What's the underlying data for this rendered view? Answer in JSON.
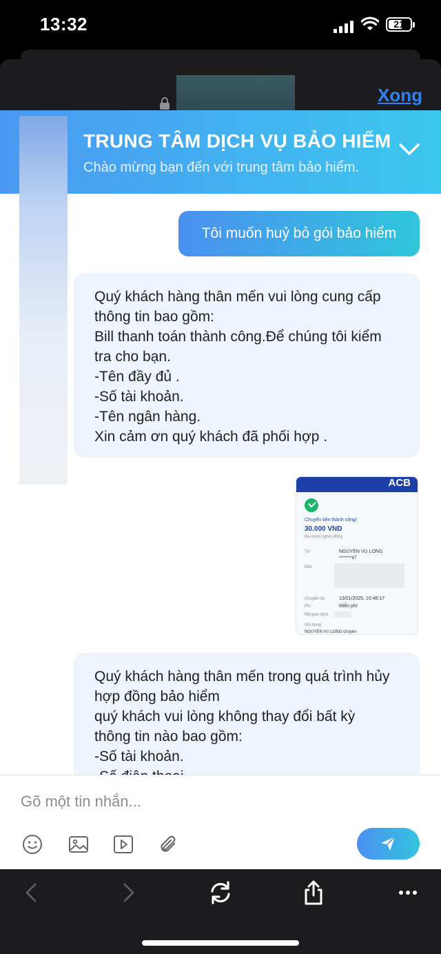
{
  "status_bar": {
    "time": "13:32",
    "battery": "21"
  },
  "browser": {
    "done_label": "Xong"
  },
  "header": {
    "title": "TRUNG TÂM DỊCH VỤ BẢO HIỂM",
    "subtitle": "Chào mừng bạn đến với trung tâm bảo hiểm."
  },
  "messages": {
    "user_1": "Tôi muốn huỷ bỏ gói bảo hiểm",
    "bot_1": "Quý khách hàng thân mến vui lòng cung cấp\nthông tin bao gồm:\nBill thanh toán thành công.Để chúng tôi kiểm\ntra cho bạn.\n-Tên đầy đủ .\n-Số tài khoản.\n-Tên ngân hàng.\nXin cảm ơn quý khách đã phối hợp .",
    "bot_2": "Quý khách hàng thân mến trong quá trình hủy\nhợp đồng bảo hiểm\nquý khách vui lòng không thay đổi bất kỳ\nthông tin nào bao gồm:\n-Số tài khoản.\n-Số điện thoại"
  },
  "receipt": {
    "bank": "ACB",
    "status": "Chuyển tiền thành công!",
    "amount": "30.000 VND",
    "amount_words": "Ba mươi nghìn đồng",
    "from_label": "Từ",
    "from_name": "NGUYEN VU LONG",
    "from_account": "********87",
    "to_label": "Đến",
    "time_label": "Chuyển lúc",
    "time_value": "13/01/2025, 10:48:17",
    "fee_label": "Phí",
    "fee_value": "Miễn phí",
    "txn_label": "Mã giao dịch",
    "content_label": "Nội dung",
    "content_value": "NGUYEN VU LONG chuyen\nkhoan"
  },
  "composer": {
    "placeholder": "Gõ một tin nhắn..."
  },
  "colors": {
    "accent": "#2e82f2",
    "header_start": "#4a98f2",
    "header_end": "#3cc7ee",
    "bot_bubble": "#eef4fd"
  }
}
